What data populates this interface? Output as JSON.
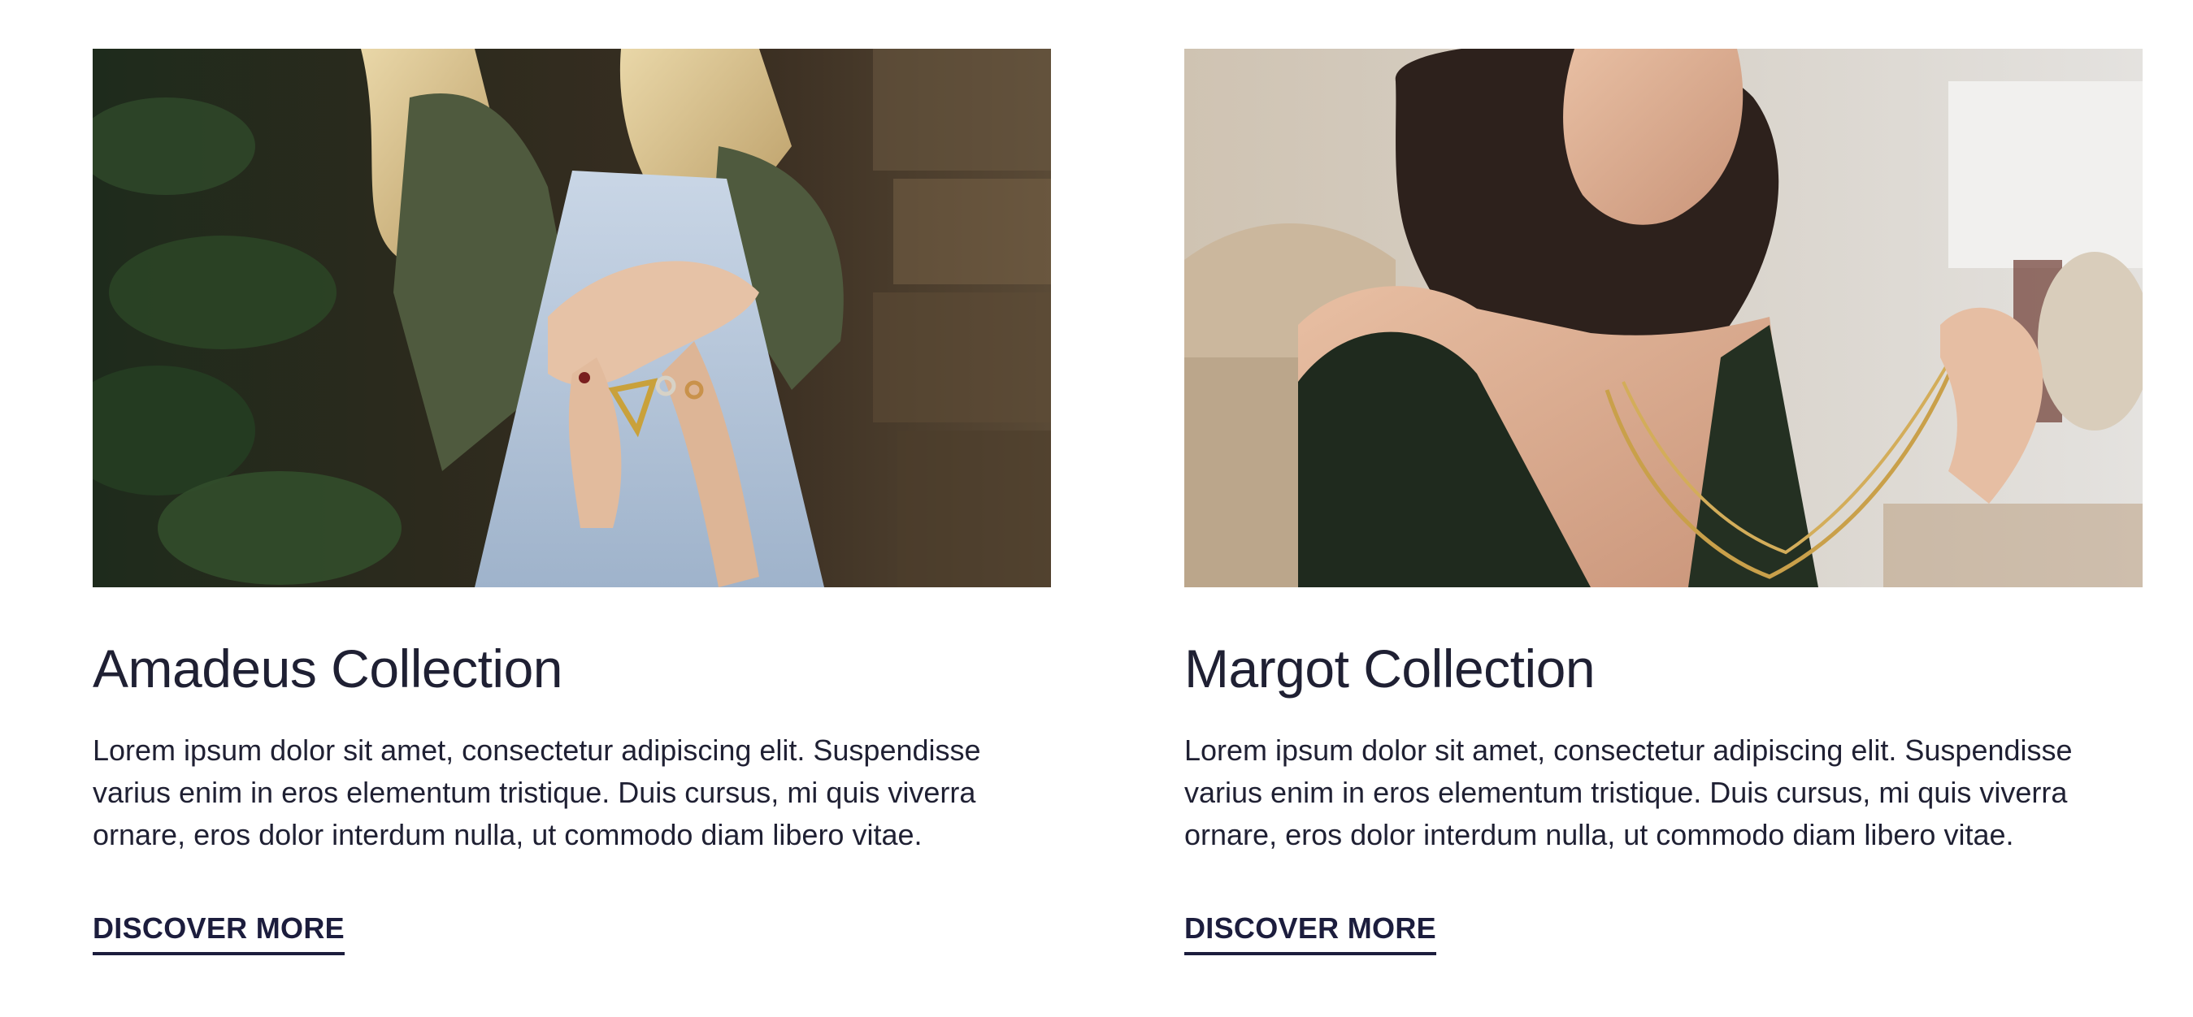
{
  "collections": [
    {
      "image_subject": "photo-of-woman-wearing-rings",
      "title": "Amadeus Collection",
      "description": "Lorem ipsum dolor sit amet, consectetur adipiscing elit. Suspendisse varius enim in eros elementum tristique. Duis cursus, mi quis viverra ornare, eros dolor interdum nulla, ut commodo diam libero vitae.",
      "cta_label": "DISCOVER MORE"
    },
    {
      "image_subject": "photo-of-woman-holding-gold-necklace",
      "title": "Margot Collection",
      "description": "Lorem ipsum dolor sit amet, consectetur adipiscing elit. Suspendisse varius enim in eros elementum tristique. Duis cursus, mi quis viverra ornare, eros dolor interdum nulla, ut commodo diam libero vitae.",
      "cta_label": "DISCOVER MORE"
    }
  ],
  "colors": {
    "text": "#1f2033",
    "cta": "#1c1d3d",
    "background": "#ffffff"
  }
}
